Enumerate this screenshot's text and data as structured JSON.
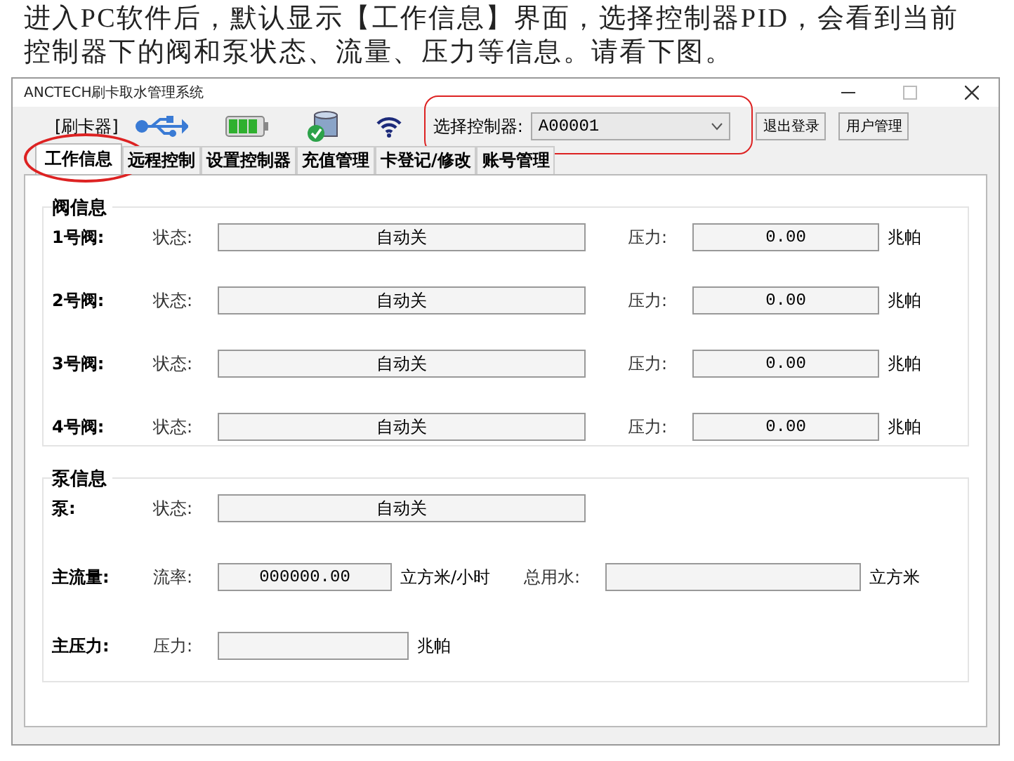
{
  "caption": "进入PC软件后，默认显示【工作信息】界面，选择控制器PID，会看到当前控制器下的阀和泵状态、流量、压力等信息。请看下图。",
  "window": {
    "title": "ANCTECH刷卡取水管理系统"
  },
  "toolbar": {
    "reader_label": "[刷卡器]",
    "controller": {
      "label": "选择控制器:",
      "value": "A00001",
      "highlighted": true
    },
    "buttons": [
      "退出登录",
      "用户管理"
    ]
  },
  "tabs": [
    {
      "label": "工作信息",
      "selected": true,
      "highlighted": true
    },
    {
      "label": "远程控制",
      "selected": false,
      "highlighted": false
    },
    {
      "label": "设置控制器",
      "selected": false,
      "highlighted": false
    },
    {
      "label": "充值管理",
      "selected": false,
      "highlighted": false
    },
    {
      "label": "卡登记/修改",
      "selected": false,
      "highlighted": false
    },
    {
      "label": "账号管理",
      "selected": false,
      "highlighted": false
    }
  ],
  "valve_group": {
    "title": "阀信息",
    "rows": [
      {
        "name": "1号阀:",
        "status_label": "状态:",
        "status": "自动关",
        "pressure_label": "压力:",
        "pressure": "0.00",
        "unit": "兆帕"
      },
      {
        "name": "2号阀:",
        "status_label": "状态:",
        "status": "自动关",
        "pressure_label": "压力:",
        "pressure": "0.00",
        "unit": "兆帕"
      },
      {
        "name": "3号阀:",
        "status_label": "状态:",
        "status": "自动关",
        "pressure_label": "压力:",
        "pressure": "0.00",
        "unit": "兆帕"
      },
      {
        "name": "4号阀:",
        "status_label": "状态:",
        "status": "自动关",
        "pressure_label": "压力:",
        "pressure": "0.00",
        "unit": "兆帕"
      }
    ]
  },
  "pump_group": {
    "title": "泵信息",
    "rows": [
      {
        "kind": "status",
        "name": "泵:",
        "label": "状态:",
        "value": "自动关"
      },
      {
        "kind": "flow",
        "name": "主流量:",
        "label": "流率:",
        "value": "000000.00",
        "unit": "立方米/小时",
        "total_label": "总用水:",
        "total_unit": "立方米"
      },
      {
        "kind": "pressure",
        "name": "主压力:",
        "label": "压力:",
        "unit": "兆帕"
      }
    ]
  }
}
